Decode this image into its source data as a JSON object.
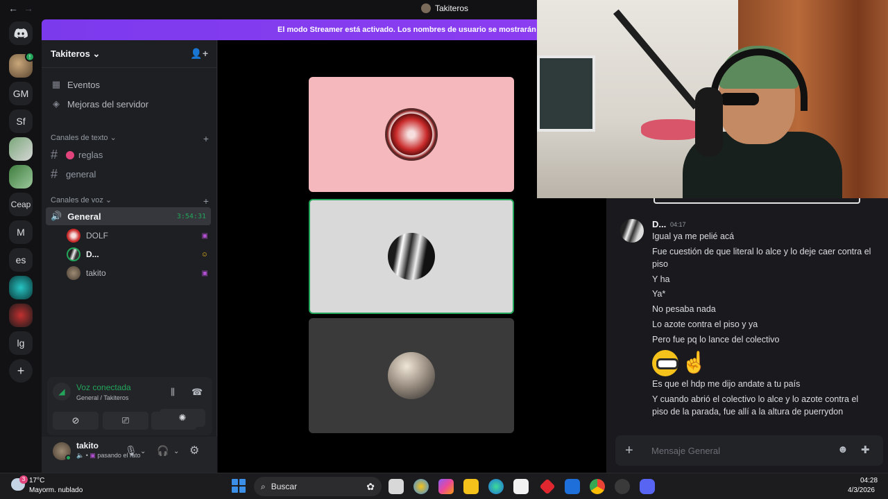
{
  "window": {
    "title": "Takiteros",
    "back_label": "←",
    "forward_label": "→"
  },
  "server_rail": {
    "servers": [
      {
        "label": "",
        "type": "image"
      },
      {
        "label": "GM"
      },
      {
        "label": "Sf"
      },
      {
        "label": "",
        "type": "image"
      },
      {
        "label": "",
        "type": "image"
      },
      {
        "label": "Ceap"
      },
      {
        "label": "M"
      },
      {
        "label": "es"
      },
      {
        "label": "",
        "type": "image"
      },
      {
        "label": "",
        "type": "image"
      },
      {
        "label": "lg"
      }
    ],
    "add_server_label": "+"
  },
  "banner": {
    "text": "El modo Streamer está activado. Los nombres de usuario se mostrarán de f"
  },
  "sidebar": {
    "server_name": "Takiteros",
    "items": [
      {
        "label": "Eventos"
      },
      {
        "label": "Mejoras del servidor"
      }
    ],
    "text_category": "Canales de texto",
    "text_channels": [
      {
        "label": "reglas"
      },
      {
        "label": "general"
      }
    ],
    "voice_category": "Canales de voz",
    "voice_channel": {
      "label": "General",
      "timer": "3:54:31"
    },
    "voice_users": [
      {
        "name": "DOLF"
      },
      {
        "name": "D..."
      },
      {
        "name": "takito"
      }
    ]
  },
  "voice_panel": {
    "status": "Voz conectada",
    "subtitle": "General / Takiteros"
  },
  "user_panel": {
    "name": "takito",
    "status": "pasando el rato"
  },
  "chat": {
    "author": "D...",
    "time": "04:17",
    "messages": [
      "Igual ya me pelié acá",
      "Fue cuestión de que literal lo alce y lo deje caer contra el piso",
      "Y ha",
      "Ya*",
      "No pesaba nada",
      "Lo azote contra el piso y ya",
      "Pero fue pq lo lance del colectivo",
      "Es que el hdp me dijo andate a tu país",
      "Y cuando abrió el colectivo lo alce y lo azote contra el piso de la parada, fue allí a la altura de puerrydon"
    ],
    "composer_placeholder": "Mensaje General"
  },
  "taskbar": {
    "weather_badge": "3",
    "temperature": "17°C",
    "weather": "Mayorm. nublado",
    "search_label": "Buscar",
    "time": "04:28",
    "date": "4/3/2026"
  },
  "colors": {
    "accent_green": "#23a55a",
    "banner_purple": "#7c3aed",
    "background": "#121214"
  }
}
